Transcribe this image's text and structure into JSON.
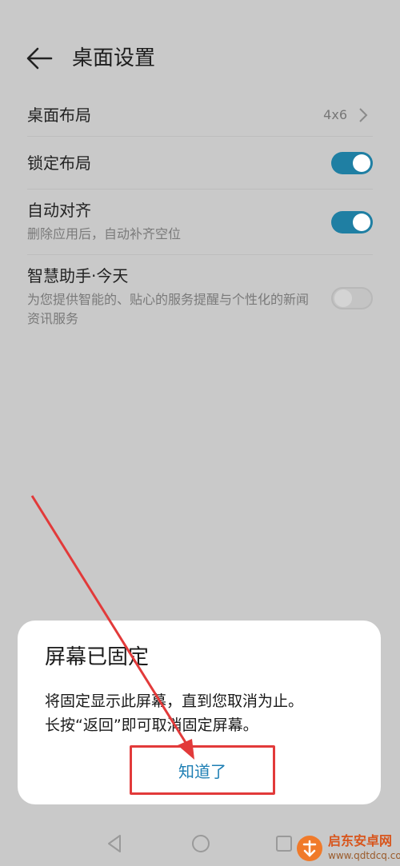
{
  "header": {
    "title": "桌面设置"
  },
  "settings": {
    "layout": {
      "label": "桌面布局",
      "value": "4x6"
    },
    "lock_layout": {
      "label": "锁定布局",
      "enabled": true
    },
    "auto_align": {
      "label": "自动对齐",
      "description": "删除应用后，自动补齐空位",
      "enabled": true
    },
    "smart_assistant": {
      "label": "智慧助手·今天",
      "description": "为您提供智能的、贴心的服务提醒与个性化的新闻资讯服务",
      "enabled": false
    }
  },
  "dialog": {
    "title": "屏幕已固定",
    "message_line1": "将固定显示此屏幕，直到您取消为止。",
    "message_line2": "长按“返回”即可取消固定屏幕。",
    "button_label": "知道了"
  },
  "watermark": {
    "name": "启东安卓网",
    "url": "www.qdtdcq.com"
  },
  "colors": {
    "accent": "#1f7fa3",
    "annotation": "#e23a3a",
    "overlay_background": "#c9c9c9"
  }
}
